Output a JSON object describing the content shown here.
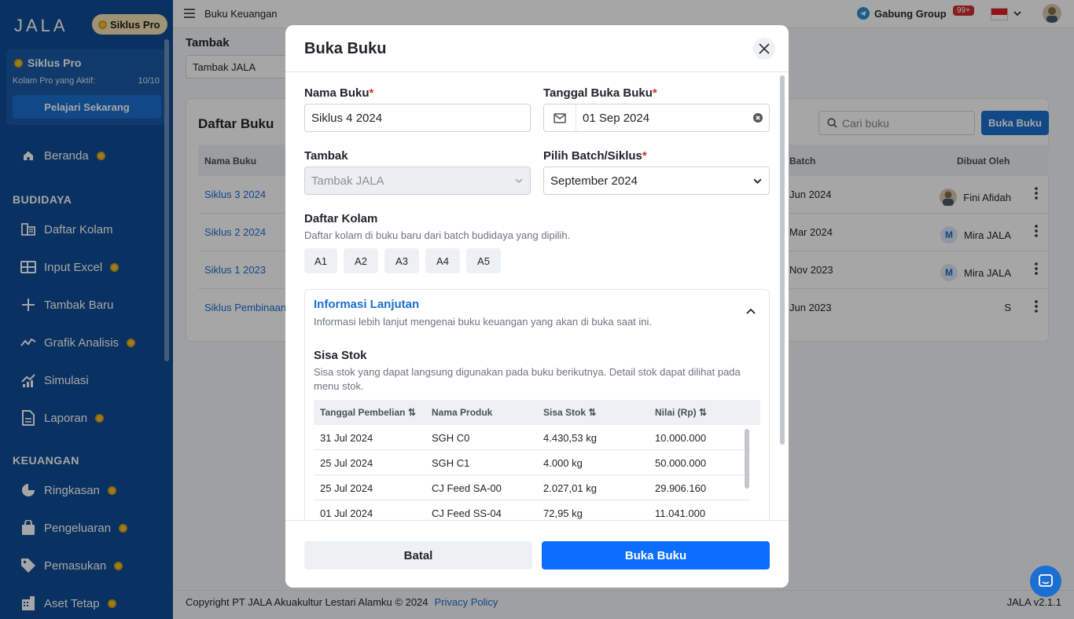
{
  "sidebar": {
    "logo": "JALA",
    "pro_pill": "Siklus Pro",
    "pro_card": {
      "title": "Siklus Pro",
      "subtitle": "Kolam Pro yang Aktif:",
      "count": "10/10",
      "button": "Pelajari Sekarang"
    },
    "home": "Beranda",
    "sections": {
      "budidaya": "BUDIDAYA",
      "keuangan": "KEUANGAN"
    },
    "items": [
      {
        "label": "Daftar Kolam"
      },
      {
        "label": "Input Excel"
      },
      {
        "label": "Tambak Baru"
      },
      {
        "label": "Grafik Analisis"
      },
      {
        "label": "Simulasi"
      },
      {
        "label": "Laporan"
      },
      {
        "label": "Ringkasan"
      },
      {
        "label": "Pengeluaran"
      },
      {
        "label": "Pemasukan"
      },
      {
        "label": "Aset Tetap"
      }
    ]
  },
  "topbar": {
    "breadcrumb": "Buku Keuangan",
    "gabung": "Gabung Group",
    "notif_badge": "99+"
  },
  "page": {
    "tambak_label": "Tambak",
    "tambak_value": "Tambak JALA",
    "card_title": "Daftar Buku",
    "search_placeholder": "Cari buku",
    "buka_button": "Buka Buku",
    "columns": {
      "nama": "Nama Buku",
      "batch": "Batch",
      "dibuat": "Dibuat Oleh"
    },
    "rows": [
      {
        "nama": "Siklus 3 2024",
        "batch": "Jun 2024",
        "by": "Fini Afidah",
        "av": ""
      },
      {
        "nama": "Siklus 2 2024",
        "batch": "Mar 2024",
        "by": "Mira JALA",
        "av": "M"
      },
      {
        "nama": "Siklus 1 2023",
        "batch": "Nov 2023",
        "by": "Mira JALA",
        "av": "M"
      },
      {
        "nama": "Siklus Pembinaan",
        "batch": "Jun 2023",
        "by": "S",
        "av": ""
      }
    ]
  },
  "footer": {
    "copyright": "Copyright PT JALA Akuakultur Lestari Alamku © 2024",
    "privacy": "Privacy Policy",
    "version": "JALA v2.1.1"
  },
  "modal": {
    "title": "Buka Buku",
    "nama_label": "Nama Buku",
    "nama_value": "Siklus 4 2024",
    "tanggal_label": "Tanggal Buka Buku",
    "tanggal_value": "01 Sep 2024",
    "tambak_label": "Tambak",
    "tambak_value": "Tambak JALA",
    "batch_label": "Pilih Batch/Siklus",
    "batch_value": "September 2024",
    "kolam_label": "Daftar Kolam",
    "kolam_desc": "Daftar kolam di buku baru dari batch budidaya yang dipilih.",
    "kolam": [
      "A1",
      "A2",
      "A3",
      "A4",
      "A5"
    ],
    "adv_title": "Informasi Lanjutan",
    "adv_desc": "Informasi lebih lanjut mengenai buku keuangan yang akan di buka saat ini.",
    "stok_title": "Sisa Stok",
    "stok_desc": "Sisa stok yang dapat langsung digunakan pada buku berikutnya. Detail stok dapat dilihat pada menu stok.",
    "stok_columns": [
      "Tanggal Pembelian",
      "Nama Produk",
      "Sisa Stok",
      "Nilai (Rp)"
    ],
    "stok_rows": [
      [
        "31 Jul 2024",
        "SGH C0",
        "4.430,53 kg",
        "10.000.000"
      ],
      [
        "25 Jul 2024",
        "SGH C1",
        "4.000 kg",
        "50.000.000"
      ],
      [
        "25 Jul 2024",
        "CJ Feed SA-00",
        "2.027,01 kg",
        "29.906.160"
      ],
      [
        "01 Jul 2024",
        "CJ Feed SS-04",
        "72,95 kg",
        "11.041.000"
      ]
    ],
    "cancel": "Batal",
    "submit": "Buka Buku"
  }
}
